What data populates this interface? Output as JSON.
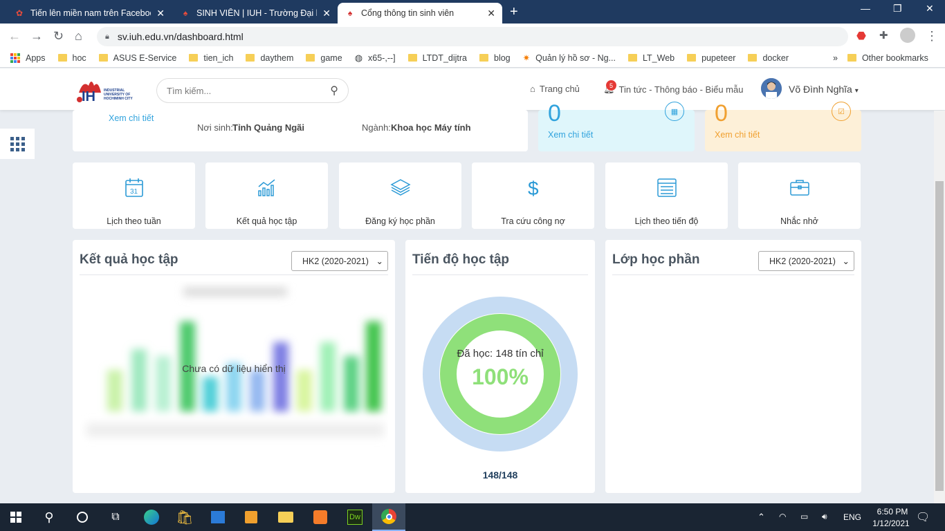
{
  "browser": {
    "tabs": [
      {
        "title": "Tiến lên miền nam trên Facebook",
        "active": false
      },
      {
        "title": "SINH VIÊN | IUH - Trường Đại học",
        "active": false
      },
      {
        "title": "Cổng thông tin sinh viên",
        "active": true
      }
    ],
    "url": "sv.iuh.edu.vn/dashboard.html",
    "bookmarks": [
      "Apps",
      "hoc",
      "ASUS E-Service",
      "tien_ich",
      "daythem",
      "game",
      "x65-,--]",
      "LTDT_dijtra",
      "blog",
      "Quản lý hồ sơ - Ng...",
      "LT_Web",
      "pupeteer",
      "docker"
    ],
    "other_bookmarks": "Other bookmarks",
    "more_bookmarks": "»"
  },
  "header": {
    "logo_text": "INDUSTRIAL UNIVERSITY OF HOCHIMINH CITY",
    "search_placeholder": "Tìm kiếm...",
    "home_label": "Trang chủ",
    "news_label": "Tin tức - Thông báo - Biểu mẫu",
    "news_badge": "5",
    "user_name": "Võ Đình Nghĩa"
  },
  "profile": {
    "detail_link": "Xem chi tiết",
    "birthplace_label": "Nơi sinh:",
    "birthplace_value": "Tỉnh Quảng Ngãi",
    "major_label": "Ngành:",
    "major_value": "Khoa học Máy tính"
  },
  "stat_cards": [
    {
      "value": "0",
      "link": "Xem chi tiết",
      "color": "#31a3dd"
    },
    {
      "value": "0",
      "link": "Xem chi tiết",
      "color": "#f0a030"
    }
  ],
  "shortcuts": [
    {
      "label": "Lịch theo tuần",
      "icon": "calendar-icon"
    },
    {
      "label": "Kết quả học tập",
      "icon": "chart-icon"
    },
    {
      "label": "Đăng ký học phần",
      "icon": "layers-icon"
    },
    {
      "label": "Tra cứu công nợ",
      "icon": "dollar-icon"
    },
    {
      "label": "Lịch theo tiến độ",
      "icon": "schedule-icon"
    },
    {
      "label": "Nhắc nhở",
      "icon": "briefcase-icon"
    }
  ],
  "results_panel": {
    "title": "Kết quả học tập",
    "semester": "HK2 (2020-2021)",
    "empty_text": "Chưa có dữ liệu hiển thị"
  },
  "progress_panel": {
    "title": "Tiến độ học tập",
    "studied_text": "Đã học: 148 tín chỉ",
    "percent_text": "100%",
    "progress": 1.0,
    "ratio_text": "148/148"
  },
  "classes_panel": {
    "title": "Lớp học phần",
    "semester": "HK2 (2020-2021)"
  },
  "taskbar": {
    "lang": "ENG",
    "time": "6:50 PM",
    "date": "1/12/2021"
  },
  "colors": {
    "accent": "#31a3dd",
    "tabstrip": "#1f3a60",
    "ring_outer": "#c6dcf3",
    "ring_inner": "#8fe07a"
  }
}
